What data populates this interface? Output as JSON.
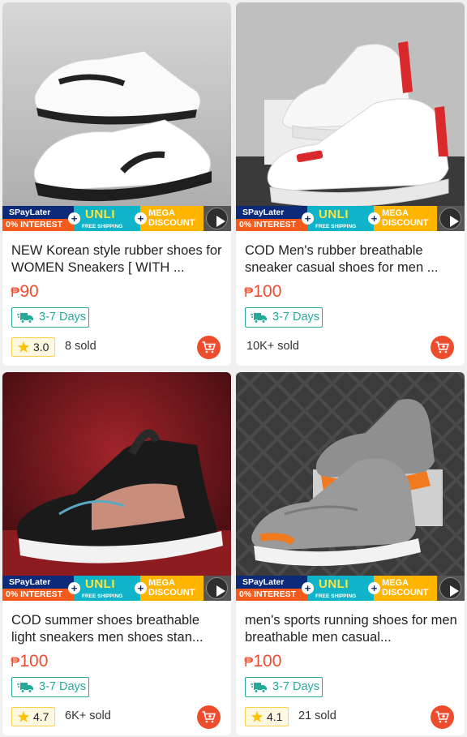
{
  "promo": {
    "spaylater": "SPayLater",
    "interest": "0% INTEREST",
    "plus": "+",
    "unli": "UNLI",
    "free_shipping": "FREE SHIPPING",
    "mega": "MEGA",
    "discount": "DISCOUNT"
  },
  "products": [
    {
      "title": "NEW  Korean style rubber shoes for WOMEN   Sneakers [ WITH ...",
      "currency": "₱",
      "price": "90",
      "shipping": "3-7 Days",
      "rating": "3.0",
      "sold": "8 sold"
    },
    {
      "title": "COD Men's rubber breathable sneaker casual shoes for men ...",
      "currency": "₱",
      "price": "100",
      "shipping": "3-7 Days",
      "sold": "10K+ sold"
    },
    {
      "title": "COD summer shoes breathable light sneakers men shoes stan...",
      "currency": "₱",
      "price": "100",
      "shipping": "3-7 Days",
      "rating": "4.7",
      "sold": "6K+ sold"
    },
    {
      "title": "men's sports running shoes for men breathable men casual...",
      "currency": "₱",
      "price": "100",
      "shipping": "3-7 Days",
      "rating": "4.1",
      "sold": "21 sold"
    }
  ],
  "icons": {
    "truck": "truck-icon",
    "star": "star-icon",
    "cart": "add-to-cart-icon",
    "play": "play-icon"
  },
  "colors": {
    "price": "#ee4d2d",
    "shipping": "#26aa99",
    "cart": "#ee4d2d"
  }
}
